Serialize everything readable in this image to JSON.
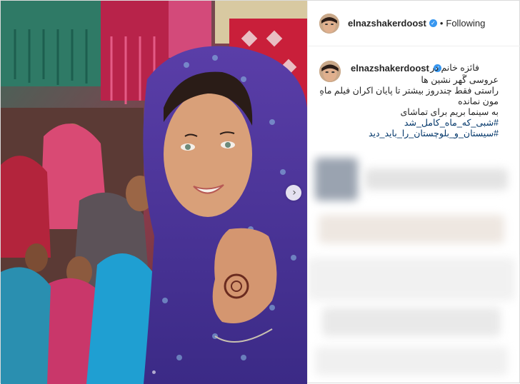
{
  "post": {
    "username": "elnazshakerdoost",
    "follow_status": "Following",
    "separator": "•",
    "verified_mark": "✓"
  },
  "caption": {
    "author_tag": "فائزه خانم در",
    "lines": [
      "عروسی گَهر نشین ها",
      "راستی فقط چندروز بیشتر تا پایان اکران فیلم ماهِ",
      "مون نمانده",
      "به سینما بریم برای تماشای",
      "#شبی_که_ماه_کامل_شد",
      "#سیستان_و_بلوچستان_را_باید_دید"
    ]
  },
  "carousel": {
    "next_glyph": "›"
  },
  "icons": {
    "verified": "verified-badge-icon",
    "next": "chevron-right-icon"
  },
  "colors": {
    "accent": "#3897f0",
    "hashtag": "#003569"
  }
}
